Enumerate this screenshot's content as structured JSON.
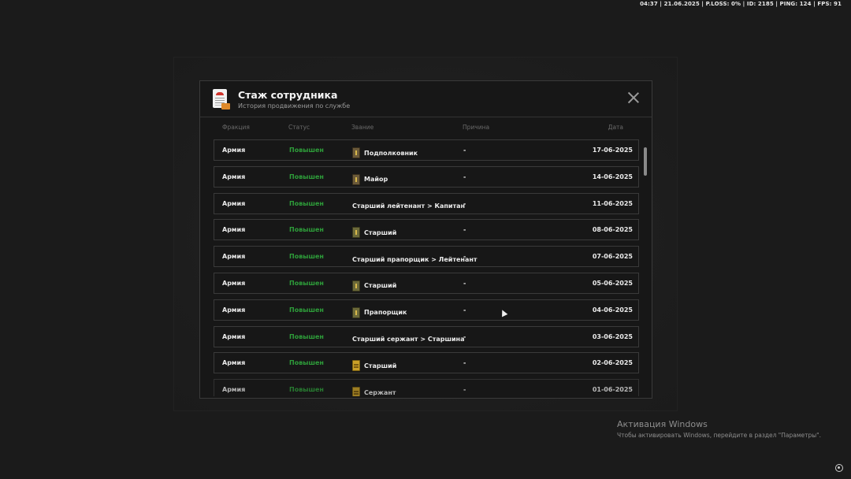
{
  "hud": {
    "text": "04:37 | 21.06.2025 | P.LOSS: 0% | ID: 2185 | PING: 124 | FPS: 91"
  },
  "modal": {
    "title": "Стаж сотрудника",
    "subtitle": "История продвижения по службе",
    "columns": {
      "faction": "Фракция",
      "status": "Статус",
      "rank": "Звание",
      "reason": "Причина",
      "date": "Дата"
    },
    "rows": [
      {
        "faction": "Армия",
        "status": "Повышен",
        "rank": "Подполковник",
        "reason": "-",
        "date": "17-06-2025",
        "icon": "rank-badge-icon"
      },
      {
        "faction": "Армия",
        "status": "Повышен",
        "rank": "Майор",
        "reason": "-",
        "date": "14-06-2025",
        "icon": "rank-badge-icon"
      },
      {
        "faction": "Армия",
        "status": "Повышен",
        "rank": "Старший лейтенант > Капитан",
        "reason": "-",
        "date": "11-06-2025",
        "icon": ""
      },
      {
        "faction": "Армия",
        "status": "Повышен",
        "rank": "Старший",
        "reason": "-",
        "date": "08-06-2025",
        "icon": "rank-badge-icon"
      },
      {
        "faction": "Армия",
        "status": "Повышен",
        "rank": "Старший прапорщик > Лейтенант",
        "reason": "-",
        "date": "07-06-2025",
        "icon": ""
      },
      {
        "faction": "Армия",
        "status": "Повышен",
        "rank": "Старший",
        "reason": "-",
        "date": "05-06-2025",
        "icon": "rank-badge-icon"
      },
      {
        "faction": "Армия",
        "status": "Повышен",
        "rank": "Прапорщик",
        "reason": "-",
        "date": "04-06-2025",
        "icon": "rank-badge-icon"
      },
      {
        "faction": "Армия",
        "status": "Повышен",
        "rank": "Старший сержант > Старшина",
        "reason": "-",
        "date": "03-06-2025",
        "icon": ""
      },
      {
        "faction": "Армия",
        "status": "Повышен",
        "rank": "Старший",
        "reason": "-",
        "date": "02-06-2025",
        "icon": "rank-badge-icon"
      },
      {
        "faction": "Армия",
        "status": "Повышен",
        "rank": "Сержант",
        "reason": "-",
        "date": "01-06-2025",
        "icon": "rank-badge-icon"
      }
    ]
  },
  "activation": {
    "title": "Активация Windows",
    "subtitle": "Чтобы активировать Windows, перейдите в раздел \"Параметры\"."
  },
  "colors": {
    "status_green": "#2e9e3a",
    "background": "#1b1b1b",
    "modal_bg": "#171717"
  }
}
